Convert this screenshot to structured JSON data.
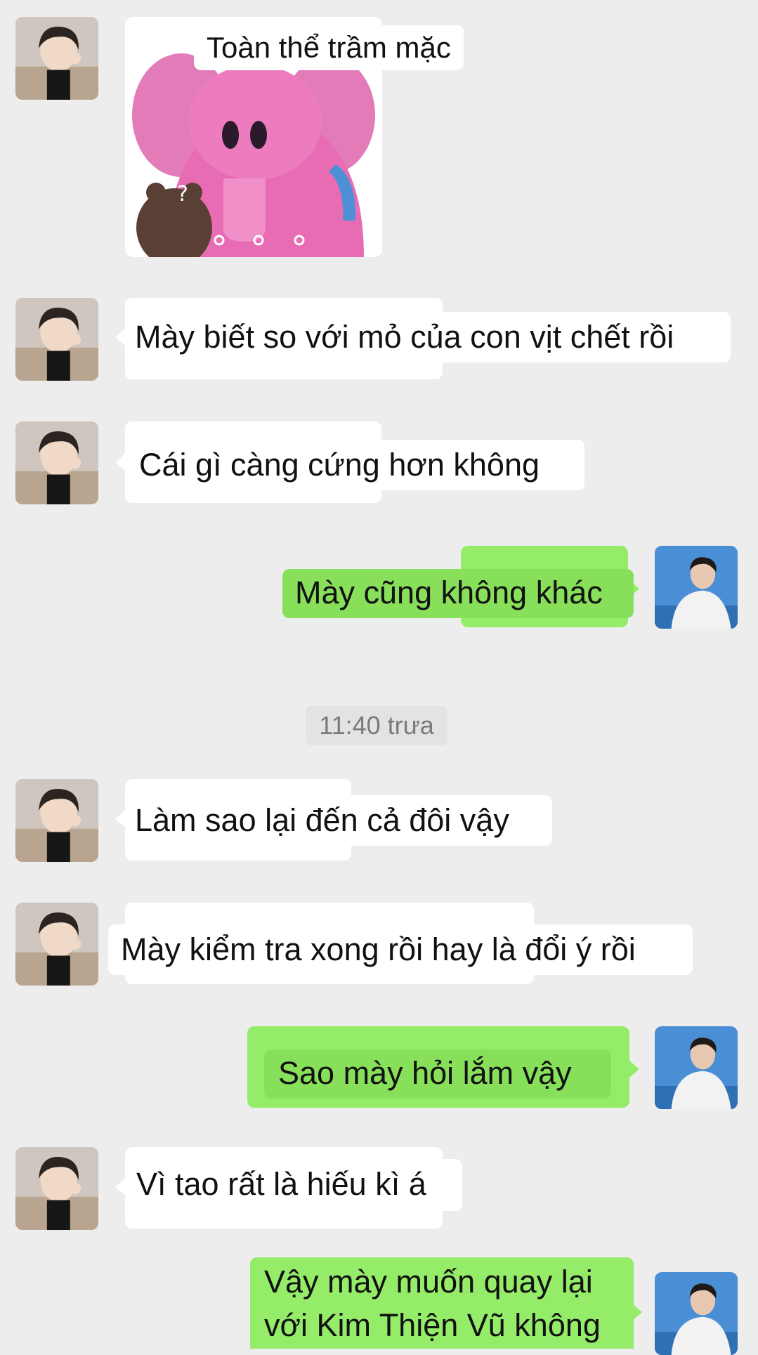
{
  "sticker": {
    "caption": "Toàn thể trầm mặc",
    "icon": "pink-elephant-sticker"
  },
  "timestamp": "11:40 trưa",
  "messages": [
    {
      "side": "left",
      "text": "Mày biết so với mỏ của con vịt chết rồi"
    },
    {
      "side": "left",
      "text": "Cái gì càng cứng hơn không"
    },
    {
      "side": "right",
      "text": "Mày cũng không khác"
    },
    {
      "side": "left",
      "text": "Làm sao lại đến cả đôi vậy"
    },
    {
      "side": "left",
      "text": "Mày kiểm tra xong rồi hay là đổi ý rồi"
    },
    {
      "side": "right",
      "text": "Sao mày hỏi lắm vậy"
    },
    {
      "side": "left",
      "text": "Vì tao rất là hiếu kì á"
    },
    {
      "side": "right",
      "lines": [
        "Vậy mày muốn quay lại",
        "với Kim Thiện Vũ không"
      ]
    }
  ],
  "colors": {
    "background": "#ededed",
    "incoming": "#ffffff",
    "outgoing": "#95ec69"
  }
}
